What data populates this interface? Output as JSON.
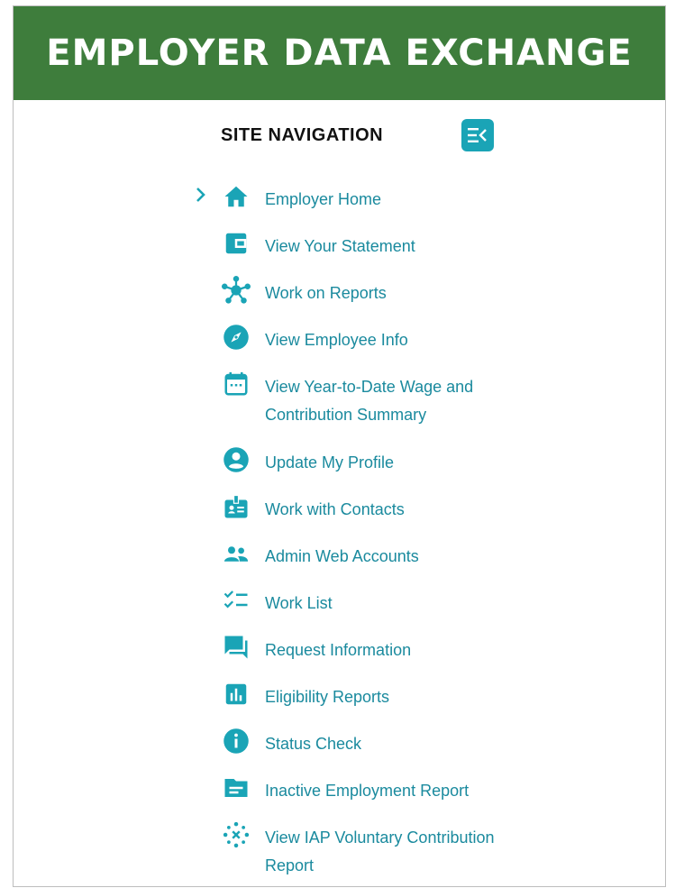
{
  "header": {
    "title": "EMPLOYER DATA EXCHANGE"
  },
  "nav": {
    "title": "SITE NAVIGATION",
    "collapse_icon": "collapse-menu-icon",
    "items": [
      {
        "label": "Employer Home",
        "icon": "home-icon",
        "active": true
      },
      {
        "label": "View Your Statement",
        "icon": "wallet-icon"
      },
      {
        "label": "Work on Reports",
        "icon": "hub-icon"
      },
      {
        "label": "View Employee Info",
        "icon": "compass-icon"
      },
      {
        "label": "View Year-to-Date Wage and Contribution Summary",
        "icon": "calendar-icon"
      },
      {
        "label": "Update My Profile",
        "icon": "account-circle-icon"
      },
      {
        "label": "Work with Contacts",
        "icon": "badge-icon"
      },
      {
        "label": "Admin Web Accounts",
        "icon": "group-icon"
      },
      {
        "label": "Work List",
        "icon": "checklist-icon"
      },
      {
        "label": "Request Information",
        "icon": "chat-icon"
      },
      {
        "label": "Eligibility Reports",
        "icon": "bar-chart-icon"
      },
      {
        "label": "Status Check",
        "icon": "info-icon"
      },
      {
        "label": "Inactive Employment Report",
        "icon": "folder-icon"
      },
      {
        "label": "View IAP Voluntary Contribution Report",
        "icon": "sparkle-icon"
      }
    ]
  },
  "colors": {
    "banner": "#3e7d3c",
    "accent": "#1aa4b6",
    "link": "#1a8a9e"
  }
}
